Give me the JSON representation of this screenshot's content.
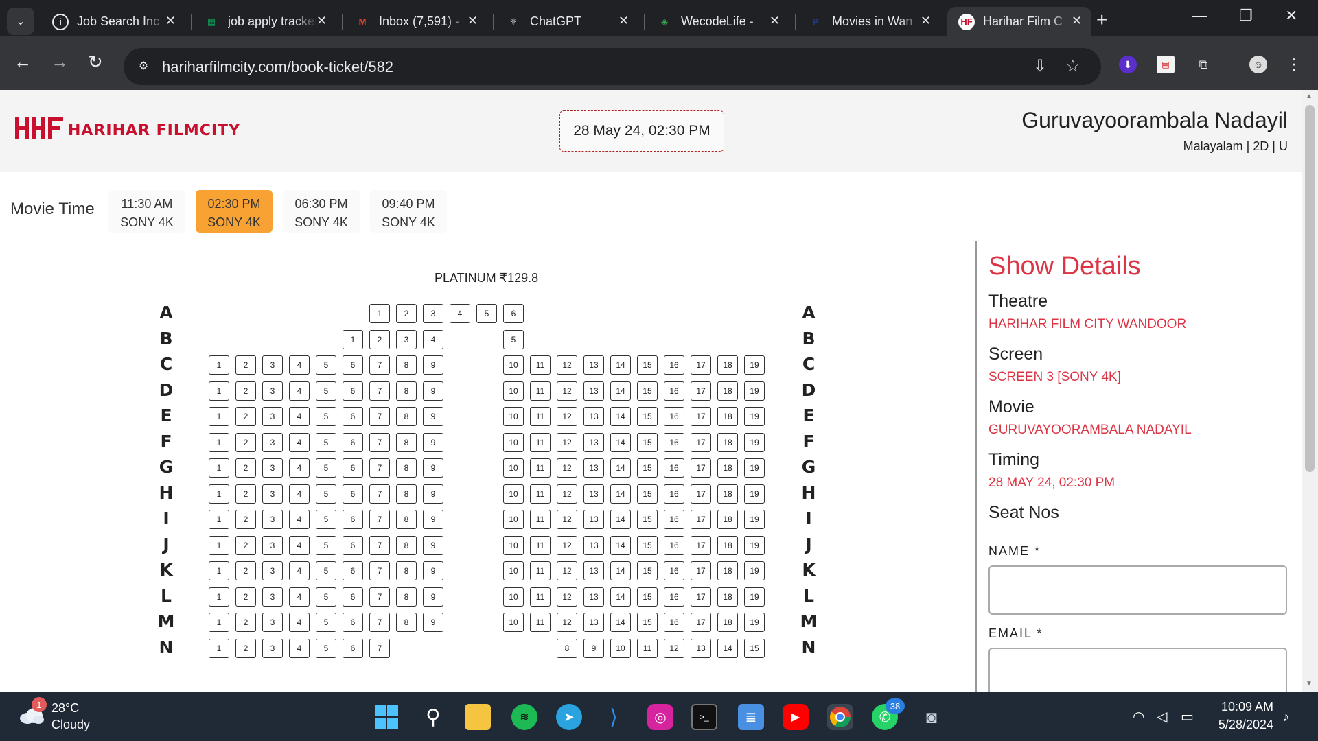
{
  "browser": {
    "tabs": [
      {
        "label": "Job Search Inc",
        "icon": "info-icon",
        "color": "#e8eaed"
      },
      {
        "label": "job apply tracker",
        "icon": "sheets-icon",
        "color": "#0f9d58"
      },
      {
        "label": "Inbox (7,591) -",
        "icon": "gmail-icon",
        "color": "#ea4335"
      },
      {
        "label": "ChatGPT",
        "icon": "chatgpt-icon",
        "color": "#e8eaed"
      },
      {
        "label": "WecodeLife - ",
        "icon": "wecode-icon",
        "color": "#34a853"
      },
      {
        "label": "Movies in Wan",
        "icon": "paytm-icon",
        "color": "#1a3aa8"
      },
      {
        "label": "Harihar Film C",
        "icon": "hf-icon",
        "color": "#c8102e",
        "active": true
      }
    ],
    "url": "hariharfilmcity.com/book-ticket/582"
  },
  "header": {
    "logo_text": "HARIHAR FILMCITY",
    "logo_mark": "HHF",
    "show_datetime": "28 May 24, 02:30 PM",
    "movie_title": "Guruvayoorambala Nadayil",
    "movie_meta": "Malayalam | 2D | U"
  },
  "movie_time": {
    "label": "Movie Time",
    "options": [
      {
        "time": "11:30 AM",
        "screen": "SONY 4K",
        "selected": false
      },
      {
        "time": "02:30 PM",
        "screen": "SONY 4K",
        "selected": true
      },
      {
        "time": "06:30 PM",
        "screen": "SONY 4K",
        "selected": false
      },
      {
        "time": "09:40 PM",
        "screen": "SONY 4K",
        "selected": false
      }
    ]
  },
  "seat_map": {
    "category": "PLATINUM ₹129.8",
    "rows": [
      {
        "letter": "A",
        "seats": [
          1,
          2,
          3,
          4,
          5,
          6
        ]
      },
      {
        "letter": "B",
        "seats": [
          1,
          2,
          3,
          4,
          5
        ]
      },
      {
        "letter": "C",
        "seats": [
          1,
          2,
          3,
          4,
          5,
          6,
          7,
          8,
          9,
          10,
          11,
          12,
          13,
          14,
          15,
          16,
          17,
          18,
          19
        ]
      },
      {
        "letter": "D",
        "seats": [
          1,
          2,
          3,
          4,
          5,
          6,
          7,
          8,
          9,
          10,
          11,
          12,
          13,
          14,
          15,
          16,
          17,
          18,
          19
        ]
      },
      {
        "letter": "E",
        "seats": [
          1,
          2,
          3,
          4,
          5,
          6,
          7,
          8,
          9,
          10,
          11,
          12,
          13,
          14,
          15,
          16,
          17,
          18,
          19
        ]
      },
      {
        "letter": "F",
        "seats": [
          1,
          2,
          3,
          4,
          5,
          6,
          7,
          8,
          9,
          10,
          11,
          12,
          13,
          14,
          15,
          16,
          17,
          18,
          19
        ]
      },
      {
        "letter": "G",
        "seats": [
          1,
          2,
          3,
          4,
          5,
          6,
          7,
          8,
          9,
          10,
          11,
          12,
          13,
          14,
          15,
          16,
          17,
          18,
          19
        ]
      },
      {
        "letter": "H",
        "seats": [
          1,
          2,
          3,
          4,
          5,
          6,
          7,
          8,
          9,
          10,
          11,
          12,
          13,
          14,
          15,
          16,
          17,
          18,
          19
        ]
      },
      {
        "letter": "I",
        "seats": [
          1,
          2,
          3,
          4,
          5,
          6,
          7,
          8,
          9,
          10,
          11,
          12,
          13,
          14,
          15,
          16,
          17,
          18,
          19
        ]
      },
      {
        "letter": "J",
        "seats": [
          1,
          2,
          3,
          4,
          5,
          6,
          7,
          8,
          9,
          10,
          11,
          12,
          13,
          14,
          15,
          16,
          17,
          18,
          19
        ]
      },
      {
        "letter": "K",
        "seats": [
          1,
          2,
          3,
          4,
          5,
          6,
          7,
          8,
          9,
          10,
          11,
          12,
          13,
          14,
          15,
          16,
          17,
          18,
          19
        ]
      },
      {
        "letter": "L",
        "seats": [
          1,
          2,
          3,
          4,
          5,
          6,
          7,
          8,
          9,
          10,
          11,
          12,
          13,
          14,
          15,
          16,
          17,
          18,
          19
        ]
      },
      {
        "letter": "M",
        "seats": [
          1,
          2,
          3,
          4,
          5,
          6,
          7,
          8,
          9,
          10,
          11,
          12,
          13,
          14,
          15,
          16,
          17,
          18,
          19
        ]
      },
      {
        "letter": "N",
        "seats": [
          1,
          2,
          3,
          4,
          5,
          6,
          7,
          8,
          9,
          10,
          11,
          12,
          13,
          14,
          15
        ]
      }
    ]
  },
  "show_details": {
    "title": "Show Details",
    "theatre_label": "Theatre",
    "theatre": "HARIHAR FILM CITY WANDOOR",
    "screen_label": "Screen",
    "screen": "SCREEN 3 [SONY 4K]",
    "movie_label": "Movie",
    "movie": "GURUVAYOORAMBALA NADAYIL",
    "timing_label": "Timing",
    "timing": "28 MAY 24, 02:30 PM",
    "seat_nos_label": "Seat Nos",
    "name_label": "NAME *",
    "email_label": "EMAIL *"
  },
  "taskbar": {
    "temperature": "28°C",
    "condition": "Cloudy",
    "weather_badge": "1",
    "whatsapp_badge": "38",
    "time": "10:09 AM",
    "date": "5/28/2024"
  },
  "colors": {
    "accent_red": "#dc3545",
    "selected_time": "#f7a233",
    "brand": "#c8102e"
  }
}
